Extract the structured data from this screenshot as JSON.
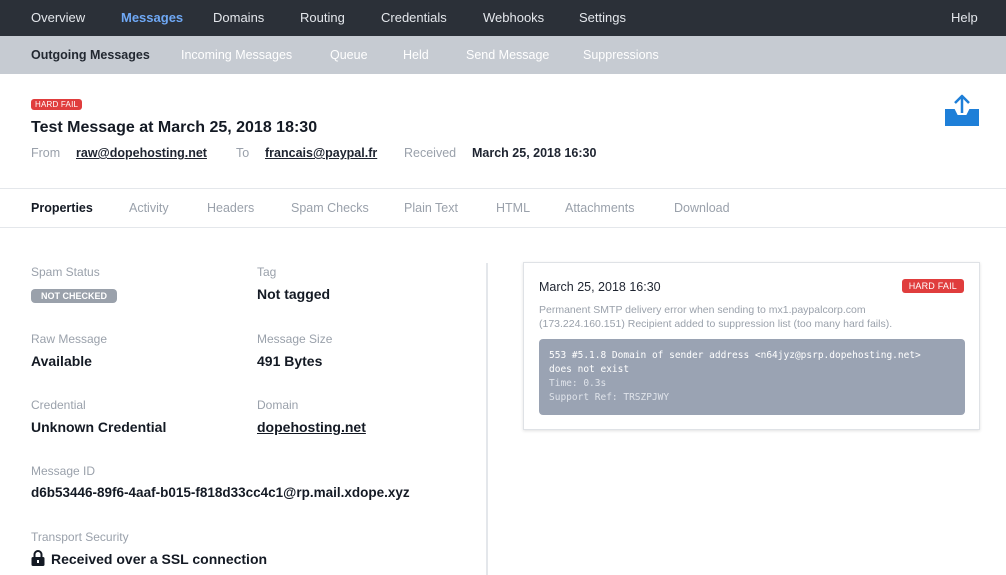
{
  "topnav": {
    "items": [
      {
        "label": "Overview"
      },
      {
        "label": "Messages"
      },
      {
        "label": "Domains"
      },
      {
        "label": "Routing"
      },
      {
        "label": "Credentials"
      },
      {
        "label": "Webhooks"
      },
      {
        "label": "Settings"
      }
    ],
    "help_label": "Help",
    "active": "Messages"
  },
  "subnav": {
    "items": [
      {
        "label": "Outgoing Messages"
      },
      {
        "label": "Incoming Messages"
      },
      {
        "label": "Queue"
      },
      {
        "label": "Held"
      },
      {
        "label": "Send Message"
      },
      {
        "label": "Suppressions"
      }
    ],
    "active": "Outgoing Messages"
  },
  "header": {
    "status_badge": "HARD FAIL",
    "title": "Test Message at March 25, 2018 18:30",
    "from_label": "From",
    "from_value": "raw@dopehosting.net",
    "to_label": "To",
    "to_value": "francais@paypal.fr",
    "received_label": "Received",
    "received_value": "March 25, 2018 16:30",
    "icon": "outbox-tray-icon"
  },
  "tabs": [
    {
      "label": "Properties"
    },
    {
      "label": "Activity"
    },
    {
      "label": "Headers"
    },
    {
      "label": "Spam Checks"
    },
    {
      "label": "Plain Text"
    },
    {
      "label": "HTML"
    },
    {
      "label": "Attachments"
    },
    {
      "label": "Download"
    }
  ],
  "properties": {
    "spam_status_label": "Spam Status",
    "spam_status_value": "NOT CHECKED",
    "tag_label": "Tag",
    "tag_value": "Not tagged",
    "raw_message_label": "Raw Message",
    "raw_message_value": "Available",
    "message_size_label": "Message Size",
    "message_size_value": "491 Bytes",
    "credential_label": "Credential",
    "credential_value": "Unknown Credential",
    "domain_label": "Domain",
    "domain_value": "dopehosting.net",
    "message_id_label": "Message ID",
    "message_id_value": "d6b53446-89f6-4aaf-b015-f818d33cc4c1@rp.mail.xdope.xyz",
    "transport_label": "Transport Security",
    "transport_value": "Received over a SSL connection"
  },
  "delivery": {
    "time": "March 25, 2018 16:30",
    "status": "HARD FAIL",
    "message_line1": "Permanent SMTP delivery error when sending to mx1.paypalcorp.com",
    "message_line2": "(173.224.160.151) Recipient added to suppression list (too many hard fails).",
    "code_line1": "553 #5.1.8 Domain of sender address <n64jyz@psrp.dopehosting.net>",
    "code_line2": "does not exist",
    "time_taken": "Time: 0.3s",
    "support_ref": "Support Ref: TRSZPJWY"
  },
  "colors": {
    "topnav_bg": "#2b3038",
    "active_nav": "#6fa8f5",
    "subnav_bg": "#c6cbd2",
    "hard_fail": "#e03d3d",
    "code_bg": "#9aa3b3",
    "icon_blue": "#1e7fd8"
  }
}
